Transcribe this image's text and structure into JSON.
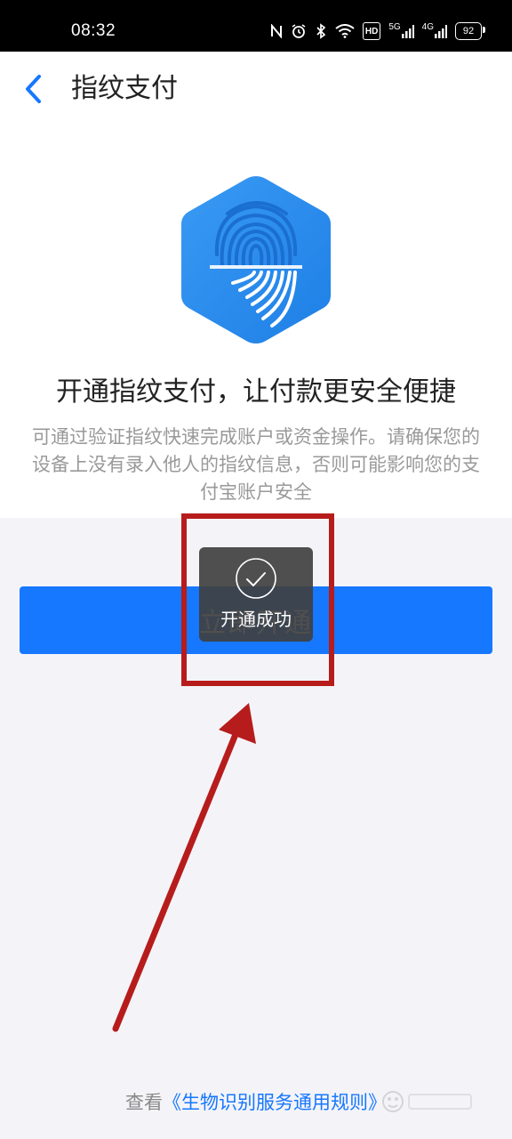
{
  "status_bar": {
    "time": "08:32",
    "icons": [
      "nfc-icon",
      "alarm-icon",
      "bluetooth-icon",
      "wifi-icon",
      "hd-icon",
      "signal-5g-icon",
      "signal-4g-icon"
    ],
    "hd_label": "HD",
    "net1_label": "5G",
    "net2_label": "4G",
    "battery": "92"
  },
  "header": {
    "title": "指纹支付",
    "back_icon": "chevron-left-icon"
  },
  "hero": {
    "icon": "fingerprint-hexagon-icon",
    "colors": {
      "primary": "#2d8cf0",
      "light": "#4aa3f5"
    }
  },
  "main": {
    "headline": "开通指纹支付，让付款更安全便捷",
    "description": "可通过验证指纹快速完成账户或资金操作。请确保您的设备上没有录入他人的指纹信息，否则可能影响您的支付宝账户安全",
    "button_label": "立即开通"
  },
  "toast": {
    "icon": "check-circle-icon",
    "text": "开通成功"
  },
  "footer": {
    "prefix": "查看",
    "link": "《生物识别服务通用规则》"
  },
  "colors": {
    "accent": "#1677ff",
    "annotation": "#b71c1c",
    "page_bg": "#f4f4f8"
  }
}
